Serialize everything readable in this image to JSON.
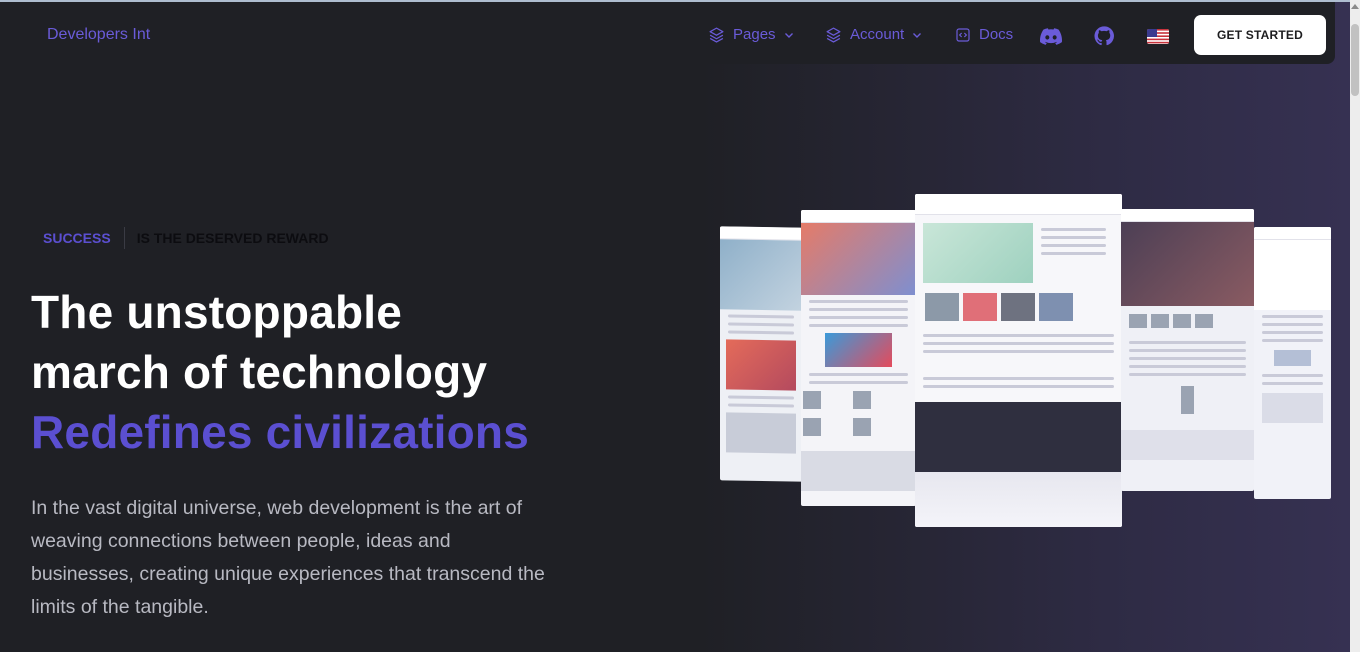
{
  "brand": "Developers Int",
  "nav": {
    "pages": "Pages",
    "account": "Account",
    "docs": "Docs",
    "discord_icon": "discord-icon",
    "github_icon": "github-icon",
    "flag": "us-flag-icon",
    "cta": "GET STARTED"
  },
  "hero": {
    "eyebrow_primary": "SUCCESS",
    "eyebrow_secondary": "IS THE DESERVED REWARD",
    "title_line1": "The unstoppable",
    "title_line2": "march of technology",
    "title_accent": "Redefines civilizations",
    "lead": "In the vast digital universe, web development is the art of weaving connections between people, ideas and businesses, creating unique experiences that transcend the limits of the tangible."
  },
  "colors": {
    "accent": "#5b4fd1",
    "background": "#1f2025",
    "cta_bg": "#ffffff"
  }
}
